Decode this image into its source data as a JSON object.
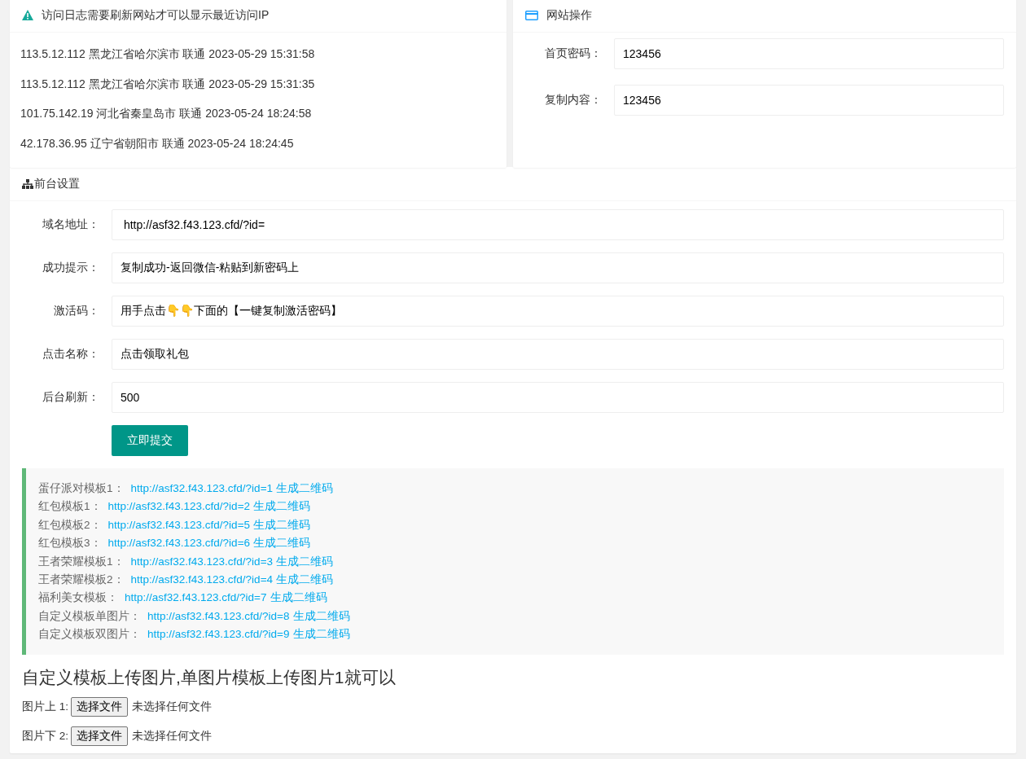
{
  "visit_log": {
    "title": "访问日志需要刷新网站才可以显示最近访问IP",
    "entries": [
      "113.5.12.112 黑龙江省哈尔滨市 联通 2023-05-29 15:31:58",
      "113.5.12.112 黑龙江省哈尔滨市 联通 2023-05-29 15:31:35",
      "101.75.142.19 河北省秦皇岛市 联通 2023-05-24 18:24:58",
      "42.178.36.95 辽宁省朝阳市 联通 2023-05-24 18:24:45"
    ]
  },
  "site_ops": {
    "title": "网站操作",
    "fields": [
      {
        "label": "首页密码：",
        "value": "123456"
      },
      {
        "label": "复制内容：",
        "value": "123456"
      }
    ]
  },
  "front_settings": {
    "title": "前台设置",
    "fields": [
      {
        "label": "域名地址：",
        "value": " http://asf32.f43.123.cfd/?id="
      },
      {
        "label": "成功提示：",
        "value": "复制成功-返回微信-粘贴到新密码上"
      },
      {
        "label": "激活码：",
        "value": "用手点击👇👇下面的【一键复制激活密码】"
      },
      {
        "label": "点击名称：",
        "value": "点击领取礼包"
      },
      {
        "label": "后台刷新：",
        "value": "500"
      }
    ],
    "submit": "立即提交",
    "templates": [
      {
        "label": "蛋仔派对模板1：",
        "url": "http://asf32.f43.123.cfd/?id=1",
        "qr": "生成二维码"
      },
      {
        "label": "红包模板1：",
        "url": "http://asf32.f43.123.cfd/?id=2",
        "qr": "生成二维码"
      },
      {
        "label": "红包模板2：",
        "url": "http://asf32.f43.123.cfd/?id=5",
        "qr": "生成二维码"
      },
      {
        "label": "红包模板3：",
        "url": "http://asf32.f43.123.cfd/?id=6",
        "qr": "生成二维码"
      },
      {
        "label": "王者荣耀模板1：",
        "url": "http://asf32.f43.123.cfd/?id=3",
        "qr": "生成二维码"
      },
      {
        "label": "王者荣耀模板2：",
        "url": "http://asf32.f43.123.cfd/?id=4",
        "qr": "生成二维码"
      },
      {
        "label": "福利美女模板：",
        "url": "http://asf32.f43.123.cfd/?id=7",
        "qr": "生成二维码"
      },
      {
        "label": "自定义模板单图片：",
        "url": "http://asf32.f43.123.cfd/?id=8",
        "qr": "生成二维码"
      },
      {
        "label": "自定义模板双图片：",
        "url": "http://asf32.f43.123.cfd/?id=9",
        "qr": "生成二维码"
      }
    ],
    "upload_heading": "自定义模板上传图片,单图片模板上传图片1就可以",
    "uploads": [
      {
        "label": "图片上 1:",
        "button": "选择文件",
        "status": "未选择任何文件"
      },
      {
        "label": "图片下 2:",
        "button": "选择文件",
        "status": "未选择任何文件"
      }
    ]
  }
}
